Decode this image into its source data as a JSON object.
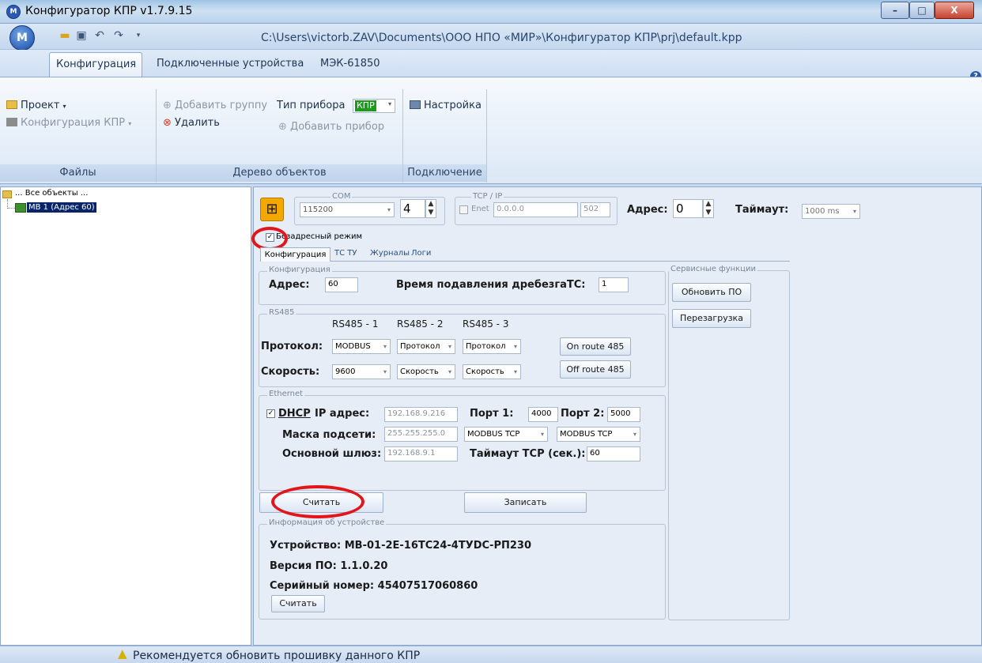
{
  "window": {
    "title": "Конфигуратор КПР v1.7.9.15",
    "file_path": "C:\\Users\\victorb.ZAV\\Documents\\ООО НПО «МИР»\\Конфигуратор КПР\\prj\\default.kpp",
    "app_icon_letter": "М",
    "btn_min": "–",
    "btn_max": "□",
    "btn_close": "X",
    "help": "?"
  },
  "ribbon": {
    "tabs": [
      "Конфигурация",
      "Подключенные устройства",
      "МЭК-61850"
    ],
    "files": {
      "project": "Проект",
      "kpr_config": "Конфигурация КПР",
      "title": "Файлы"
    },
    "tree_group": {
      "add_group": "Добавить группу",
      "device_type_label": "Тип прибора",
      "device_type_value": "КПР",
      "delete": "Удалить",
      "add_device": "Добавить прибор",
      "title": "Дерево объектов"
    },
    "connection": {
      "settings": "Настройка",
      "title": "Подключение"
    }
  },
  "tree": {
    "root": "... Все объекты ...",
    "node_name": "МВ 1",
    "node_addr": "(Адрес 60)"
  },
  "connection_bar": {
    "com_legend": "COM",
    "baud": "115200",
    "port": "4",
    "tcp_legend": "TCP / IP",
    "enet_label": "Enet",
    "ip": "0.0.0.0",
    "tcp_port": "502",
    "address_label": "Адрес:",
    "address": "0",
    "timeout_label": "Таймаут:",
    "timeout": "1000 ms",
    "addressless_label": "Безадресный режим"
  },
  "subtabs": [
    "Конфигурация",
    "ТС ТУ",
    "Журналы",
    "Логи"
  ],
  "config": {
    "legend": "Конфигурация",
    "address_label": "Адрес:",
    "address": "60",
    "debounce_label": "Время подавления дребезгаТС:",
    "debounce": "1"
  },
  "rs485": {
    "legend": "RS485",
    "col1": "RS485 - 1",
    "col2": "RS485 - 2",
    "col3": "RS485 - 3",
    "protocol_label": "Протокол:",
    "protocol1": "MODBUS",
    "protocol2": "Протокол",
    "protocol3": "Протокол",
    "speed_label": "Скорость:",
    "speed1": "9600",
    "speed2": "Скорость",
    "speed3": "Скорость",
    "on_route": "On route 485",
    "off_route": "Off route 485"
  },
  "ethernet": {
    "legend": "Ethernet",
    "dhcp_label": "DHCP",
    "ip_label": "IP адрес:",
    "ip": "192.168.9.216",
    "port1_label": "Порт 1:",
    "port1": "4000",
    "port2_label": "Порт 2:",
    "port2": "5000",
    "mask_label": "Маска подсети:",
    "mask": "255.255.255.0",
    "proto1": "MODBUS TCP",
    "proto2": "MODBUS TCP",
    "gateway_label": "Основной шлюз:",
    "gateway": "192.168.9.1",
    "tcp_timeout_label": "Таймаут TCP (сек.):",
    "tcp_timeout": "60"
  },
  "actions": {
    "read": "Считать",
    "write": "Записать"
  },
  "device_info": {
    "legend": "Информация об устройстве",
    "device_label": "Устройство:",
    "device": "МВ-01-2Е-16ТС24-4ТУDС-РП230",
    "fw_label": "Версия ПО:",
    "fw": "1.1.0.20",
    "serial_label": "Серийный номер:",
    "serial": "45407517060860",
    "read": "Считать"
  },
  "service": {
    "legend": "Сервисные функции",
    "update_fw": "Обновить ПО",
    "reboot": "Перезагрузка"
  },
  "status": {
    "message": "Рекомендуется обновить прошивку данного КПР"
  },
  "colors": {
    "accent_red": "#e3151b",
    "kpr_green": "#1a9b1a"
  }
}
